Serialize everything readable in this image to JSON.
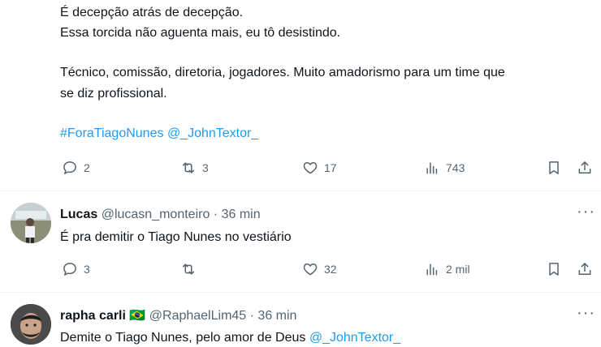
{
  "tweet1": {
    "lines": [
      "É decepção atrás de decepção.",
      "Essa torcida não aguenta mais, eu tô desistindo.",
      "Técnico, comissão, diretoria, jogadores. Muito amadorismo para um time que",
      "se diz profissional."
    ],
    "hashtag": "#ForaTiagoNunes",
    "mention": "@_JohnTextor_",
    "replies": "2",
    "retweets": "3",
    "likes": "17",
    "views": "743"
  },
  "tweet2": {
    "name": "Lucas",
    "handle": "@lucasn_monteiro",
    "separator": "·",
    "time": "36 min",
    "text": "É pra demitir o Tiago Nunes no vestiário",
    "replies": "3",
    "retweets": "",
    "likes": "32",
    "views": "2 mil"
  },
  "tweet3": {
    "name": "rapha carli",
    "flag": "🇧🇷",
    "handle": "@RaphaelLim45",
    "separator": "·",
    "time": "36 min",
    "text_prefix": "Demite o Tiago Nunes, pelo amor de Deus",
    "mention": "@_JohnTextor_"
  },
  "more_label": "···",
  "colors": {
    "link": "#1d9bf0",
    "secondary": "#536471",
    "divider": "#eff3f4"
  }
}
